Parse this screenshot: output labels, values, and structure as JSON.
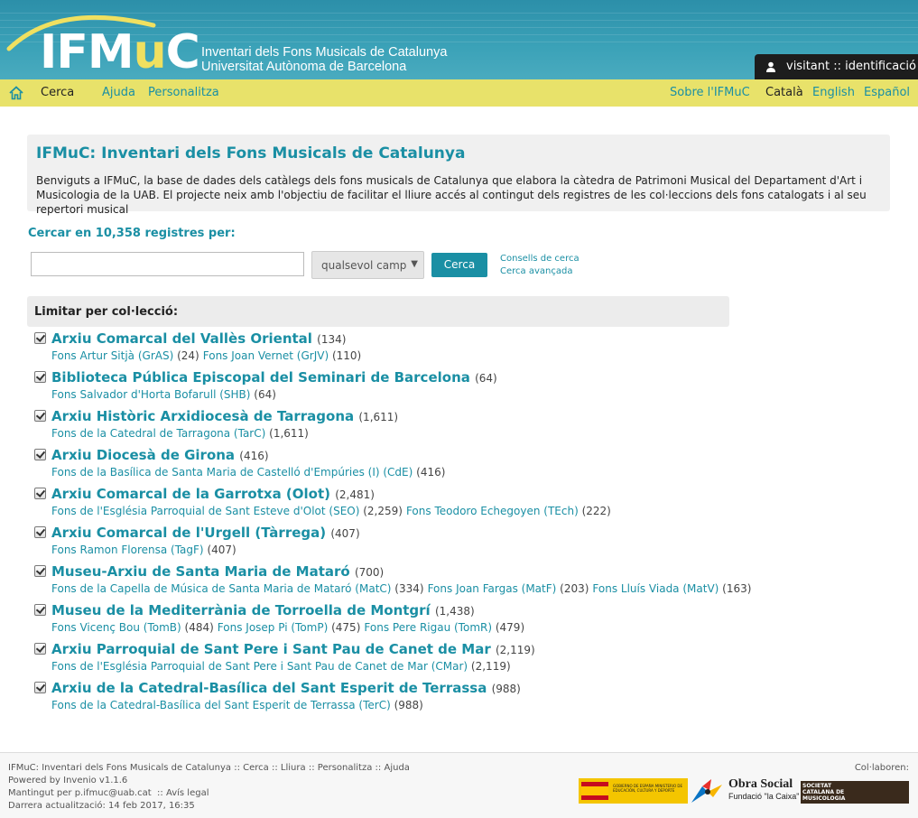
{
  "header": {
    "logo_ifm": "IFM",
    "logo_mu": "u",
    "logo_c": "C",
    "subtitle_line1": "Inventari dels Fons Musicals de Catalunya",
    "subtitle_line2": "Universitat Autònoma de Barcelona",
    "login_label": "visitant :: identificació"
  },
  "nav": {
    "home_icon": "home-icon",
    "search": "Cerca",
    "help": "Ajuda",
    "personalize": "Personalitza",
    "about": "Sobre l'IFMuC",
    "lang_ca": "Català",
    "lang_en": "English",
    "lang_es": "Español"
  },
  "intro": {
    "title": "IFMuC: Inventari dels Fons Musicals de Catalunya",
    "text": "Benviguts a IFMuC, la base de dades dels catàlegs dels fons musicals de Catalunya que elabora la càtedra de Patrimoni Musical del Departament d'Art i Musicologia de la UAB. El projecte neix amb l'objectiu de facilitar el lliure accés al contingut dels registres de les col·leccions dels fons catalogats i al seu repertori musical"
  },
  "search": {
    "label": "Cercar en 10,358 registres per:",
    "input_value": "",
    "select_value": "qualsevol camp",
    "button": "Cerca",
    "tips": "Consells de cerca",
    "advanced": "Cerca avançada"
  },
  "limit_label": "Limitar per col·lecció:",
  "collections": [
    {
      "title": "Arxiu Comarcal del Vallès Oriental",
      "count": "(134)",
      "subs": [
        {
          "name": "Fons Artur Sitjà (GrAS)",
          "count": "(24)"
        },
        {
          "name": "Fons Joan Vernet (GrJV)",
          "count": "(110)"
        }
      ]
    },
    {
      "title": "Biblioteca Pública Episcopal del Seminari de Barcelona",
      "count": "(64)",
      "subs": [
        {
          "name": "Fons Salvador d'Horta Bofarull (SHB)",
          "count": "(64)"
        }
      ]
    },
    {
      "title": "Arxiu Històric Arxidiocesà de Tarragona",
      "count": "(1,611)",
      "subs": [
        {
          "name": "Fons de la Catedral de Tarragona (TarC)",
          "count": "(1,611)"
        }
      ]
    },
    {
      "title": "Arxiu Diocesà de Girona",
      "count": "(416)",
      "subs": [
        {
          "name": "Fons de la Basílica de Santa Maria de Castelló d'Empúries (I) (CdE)",
          "count": "(416)"
        }
      ]
    },
    {
      "title": "Arxiu Comarcal de la Garrotxa (Olot)",
      "count": "(2,481)",
      "subs": [
        {
          "name": "Fons de l'Església Parroquial de Sant Esteve d'Olot (SEO)",
          "count": "(2,259)"
        },
        {
          "name": "Fons Teodoro Echegoyen (TEch)",
          "count": "(222)"
        }
      ]
    },
    {
      "title": "Arxiu Comarcal de l'Urgell (Tàrrega)",
      "count": "(407)",
      "subs": [
        {
          "name": "Fons Ramon Florensa (TagF)",
          "count": "(407)"
        }
      ]
    },
    {
      "title": "Museu-Arxiu de Santa Maria de Mataró",
      "count": "(700)",
      "subs": [
        {
          "name": "Fons de la Capella de Música de Santa Maria de Mataró (MatC)",
          "count": "(334)"
        },
        {
          "name": "Fons Joan Fargas (MatF)",
          "count": "(203)"
        },
        {
          "name": "Fons Lluís Viada (MatV)",
          "count": "(163)"
        }
      ]
    },
    {
      "title": "Museu de la Mediterrània de Torroella de Montgrí",
      "count": "(1,438)",
      "subs": [
        {
          "name": "Fons Vicenç Bou (TomB)",
          "count": "(484)"
        },
        {
          "name": "Fons Josep Pi (TomP)",
          "count": "(475)"
        },
        {
          "name": "Fons Pere Rigau (TomR)",
          "count": "(479)"
        }
      ]
    },
    {
      "title": "Arxiu Parroquial de Sant Pere i Sant Pau de Canet de Mar",
      "count": "(2,119)",
      "subs": [
        {
          "name": "Fons de l'Església Parroquial de Sant Pere i Sant Pau de Canet de Mar (CMar)",
          "count": "(2,119)"
        }
      ]
    },
    {
      "title": "Arxiu de la Catedral-Basílica del Sant Esperit de Terrassa",
      "count": "(988)",
      "subs": [
        {
          "name": "Fons de la Catedral-Basílica del Sant Esperit de Terrassa (TerC)",
          "count": "(988)"
        }
      ]
    }
  ],
  "footer": {
    "site": "IFMuC: Inventari dels Fons Musicals de Catalunya",
    "sep": "::",
    "l_search": "Cerca",
    "l_free": "Lliura",
    "l_personalize": "Personalitza",
    "l_help": "Ajuda",
    "powered": "Powered by Invenio v1.1.6",
    "maintained": "Mantingut per p.ifmuc@uab.cat",
    "legal": "Avís legal",
    "updated": "Darrera actualització: 14 feb 2017, 16:35",
    "collab": "Col·laboren:",
    "gov_text": "GOBIERNO DE ESPAÑA   MINISTERIO DE EDUCACIÓN, CULTURA Y DEPORTE",
    "obra_social": "Obra Social",
    "fundacio": "Fundació \"la Caixa\"",
    "scm": "SOCIETAT CATALANA DE MUSICOLOGIA"
  }
}
